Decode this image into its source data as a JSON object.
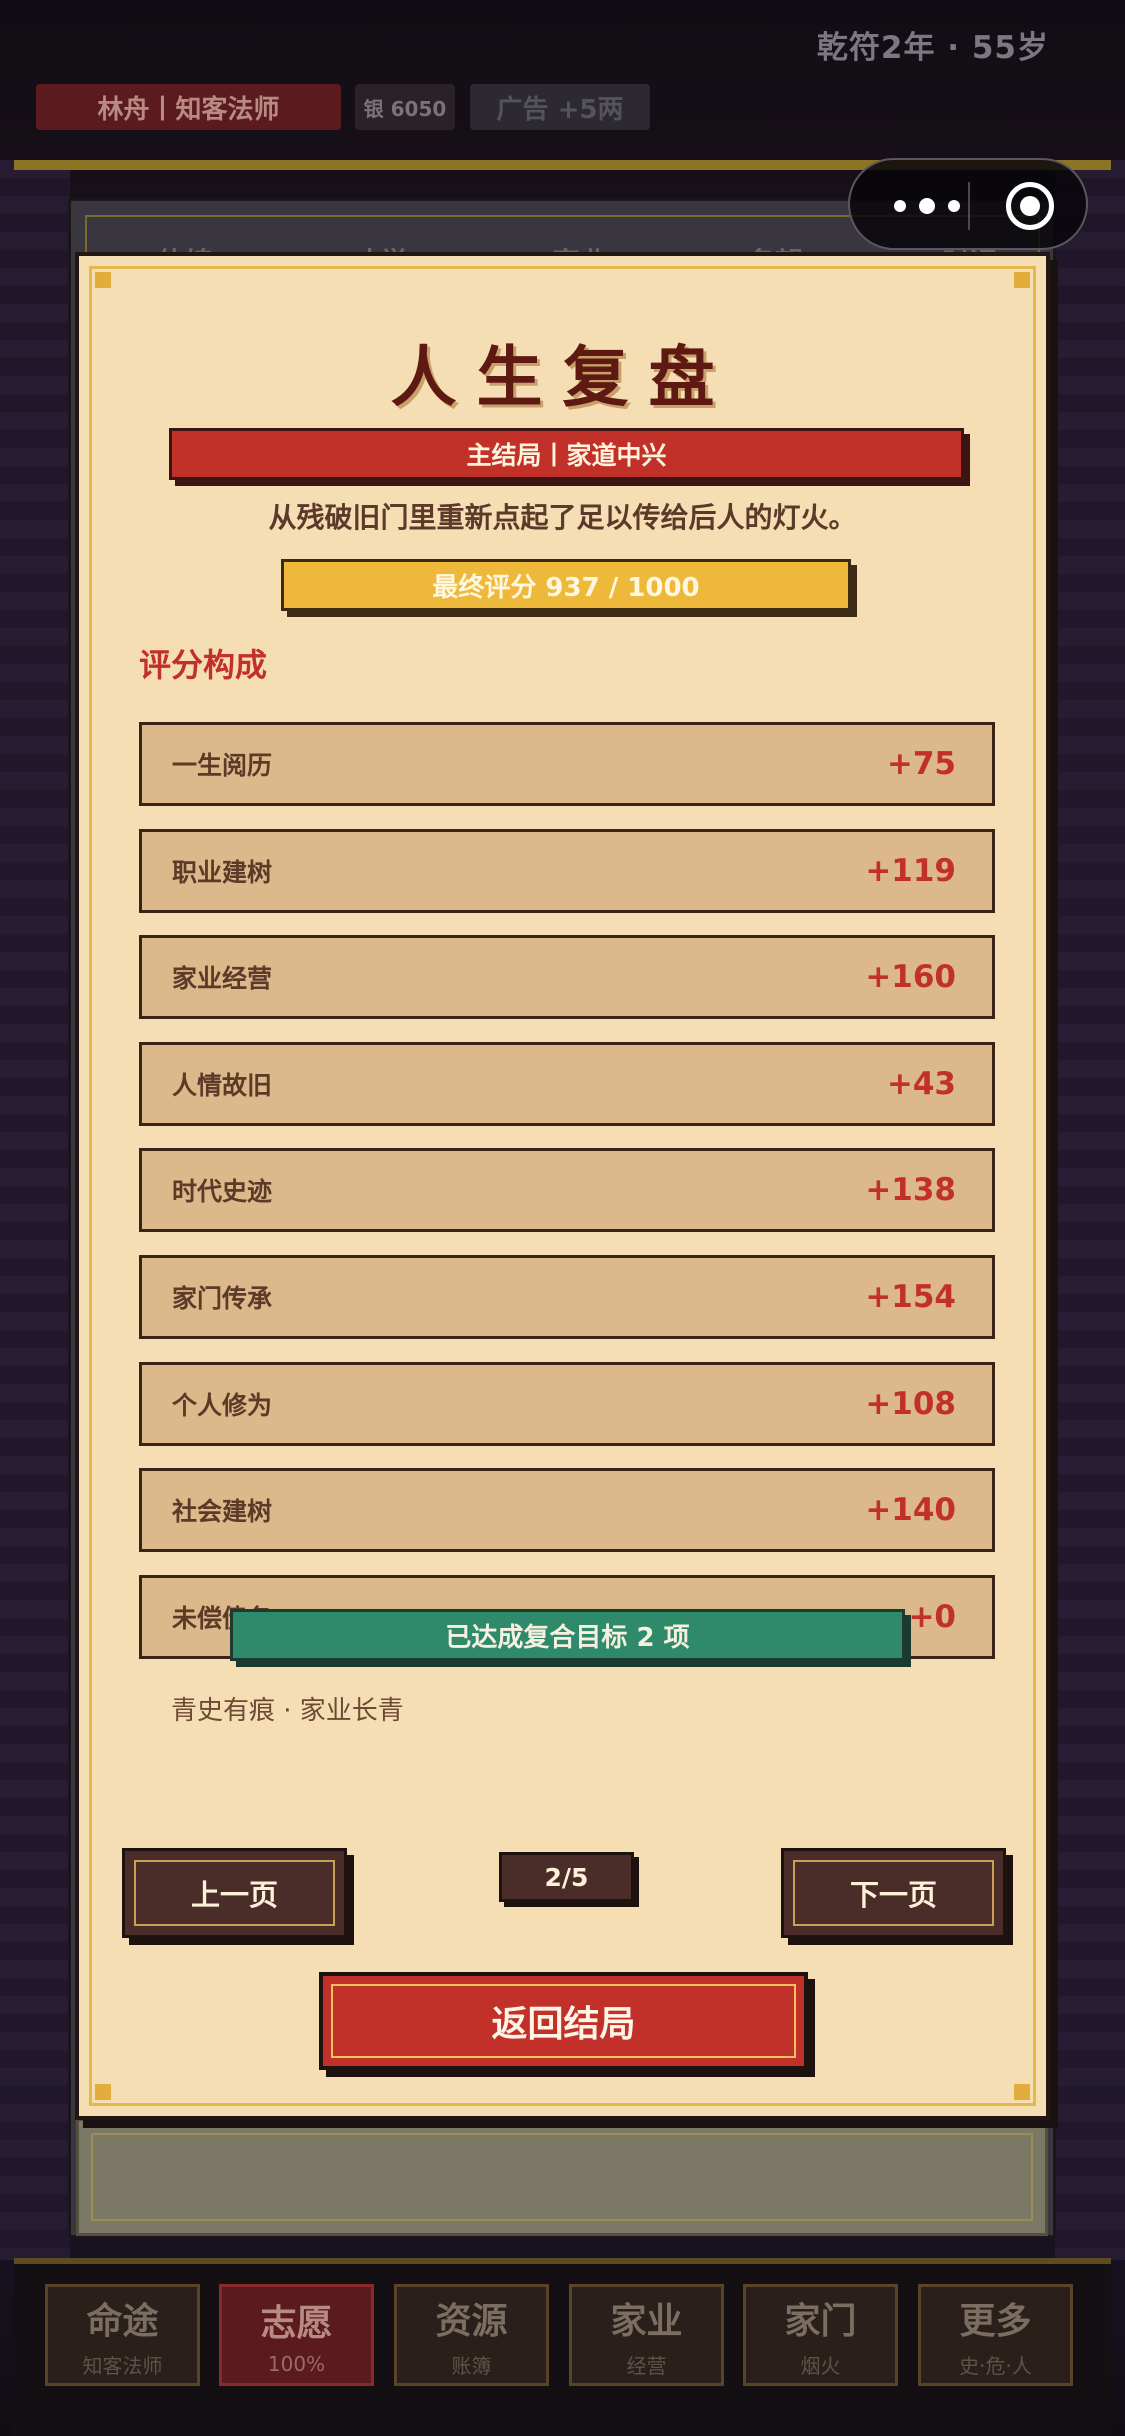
{
  "status": {
    "year_age": "乾符2年 · 55岁",
    "role": "林舟丨知客法师",
    "silver": "银 6050",
    "ad": "广告 +5两"
  },
  "capsule": {
    "more_icon": "more-dots-icon",
    "close_icon": "target-circle-icon"
  },
  "back_tabs": [
    "体魄",
    "才学",
    "家业",
    "名望",
    "时运"
  ],
  "modal": {
    "title": "人生复盘",
    "result_banner": "主结局丨家道中兴",
    "tagline": "从残破旧门里重新点起了足以传给后人的灯火。",
    "final_score": "最终评分 937 / 1000",
    "section_title": "评分构成",
    "rows": [
      {
        "label": "一生阅历",
        "value": "+75"
      },
      {
        "label": "职业建树",
        "value": "+119"
      },
      {
        "label": "家业经营",
        "value": "+160"
      },
      {
        "label": "人情故旧",
        "value": "+43"
      },
      {
        "label": "时代史迹",
        "value": "+138"
      },
      {
        "label": "家门传承",
        "value": "+154"
      },
      {
        "label": "个人修为",
        "value": "+108"
      },
      {
        "label": "社会建树",
        "value": "+140"
      },
      {
        "label": "未偿债务",
        "value": "+0"
      }
    ],
    "goal_banner": "已达成复合目标 2 项",
    "honors": "青史有痕 · 家业长青",
    "prev_label": "上一页",
    "page_indicator": "2/5",
    "next_label": "下一页",
    "return_label": "返回结局"
  },
  "bottom_nav": [
    {
      "title": "命途",
      "sub": "知客法师"
    },
    {
      "title": "志愿",
      "sub": "100%"
    },
    {
      "title": "资源",
      "sub": "账簿"
    },
    {
      "title": "家业",
      "sub": "经营"
    },
    {
      "title": "家门",
      "sub": "烟火"
    },
    {
      "title": "更多",
      "sub": "史·危·人"
    }
  ],
  "colors": {
    "accent_red": "#c2302a",
    "gold": "#eeb93a",
    "parchment": "#f6deb4",
    "goal_green": "#2f8a6c"
  }
}
